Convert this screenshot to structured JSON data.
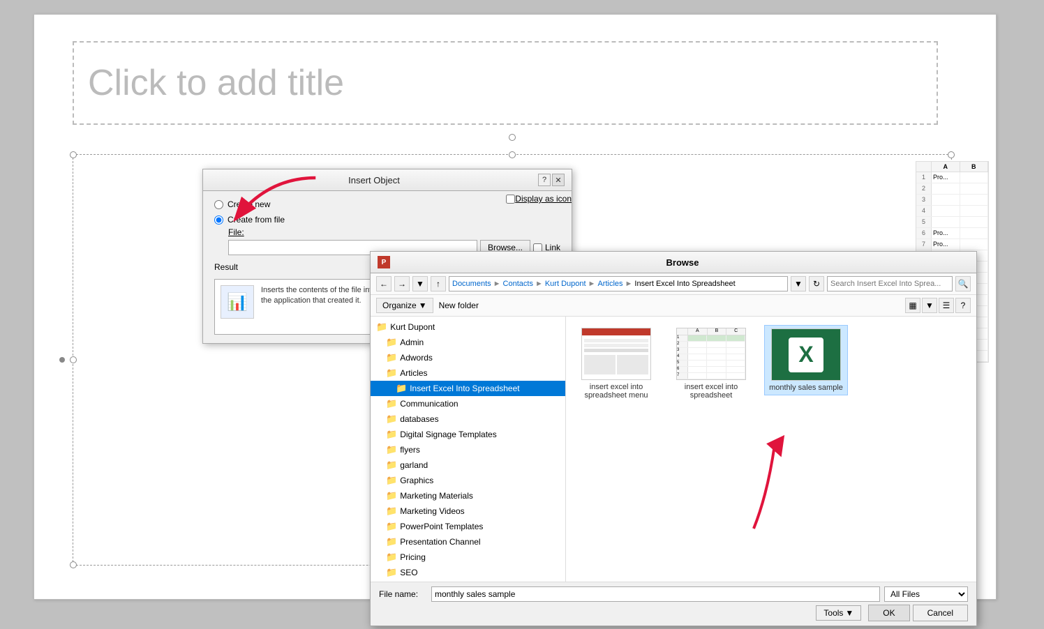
{
  "slide": {
    "title_placeholder": "Click to add title"
  },
  "insert_object_dialog": {
    "title": "Insert Object",
    "help_label": "?",
    "close_label": "✕",
    "create_new_label": "Create new",
    "create_from_file_label": "Create from file",
    "file_label": "File:",
    "browse_btn": "Browse...",
    "link_label": "Link",
    "display_as_icon_label": "Display as icon",
    "result_title": "Result",
    "result_desc": "Inserts the contents of the file into your presentation so that you can activate it using the application that created it."
  },
  "browse_dialog": {
    "title": "Browse",
    "breadcrumb": {
      "documents": "Documents",
      "contacts": "Contacts",
      "kurt_dupont": "Kurt Dupont",
      "articles": "Articles",
      "current": "Insert Excel Into Spreadsheet"
    },
    "search_placeholder": "Search Insert Excel Into Sprea...",
    "organize_label": "Organize",
    "new_folder_label": "New folder",
    "tree_items": [
      {
        "label": "Kurt Dupont",
        "indent": 0,
        "selected": false
      },
      {
        "label": "Admin",
        "indent": 1,
        "selected": false
      },
      {
        "label": "Adwords",
        "indent": 1,
        "selected": false
      },
      {
        "label": "Articles",
        "indent": 1,
        "selected": false
      },
      {
        "label": "Insert Excel Into Spreadsheet",
        "indent": 2,
        "selected": true
      },
      {
        "label": "Communication",
        "indent": 1,
        "selected": false
      },
      {
        "label": "databases",
        "indent": 1,
        "selected": false
      },
      {
        "label": "Digital Signage Templates",
        "indent": 1,
        "selected": false
      },
      {
        "label": "flyers",
        "indent": 1,
        "selected": false
      },
      {
        "label": "garland",
        "indent": 1,
        "selected": false
      },
      {
        "label": "Graphics",
        "indent": 1,
        "selected": false
      },
      {
        "label": "Marketing Materials",
        "indent": 1,
        "selected": false
      },
      {
        "label": "Marketing Videos",
        "indent": 1,
        "selected": false
      },
      {
        "label": "PowerPoint Templates",
        "indent": 1,
        "selected": false
      },
      {
        "label": "Presentation Channel",
        "indent": 1,
        "selected": false
      },
      {
        "label": "Pricing",
        "indent": 1,
        "selected": false
      },
      {
        "label": "SEO",
        "indent": 1,
        "selected": false
      }
    ],
    "files": [
      {
        "name": "insert excel into spreadsheet menu",
        "type": "ppt"
      },
      {
        "name": "insert excel into spreadsheet",
        "type": "excel_small"
      },
      {
        "name": "monthly sales sample",
        "type": "excel_icon",
        "selected": true
      }
    ],
    "filename_label": "File name:",
    "filename_value": "monthly sales sample",
    "filetype_label": "All Files",
    "tools_label": "Tools",
    "ok_label": "OK",
    "cancel_label": "Cancel"
  }
}
